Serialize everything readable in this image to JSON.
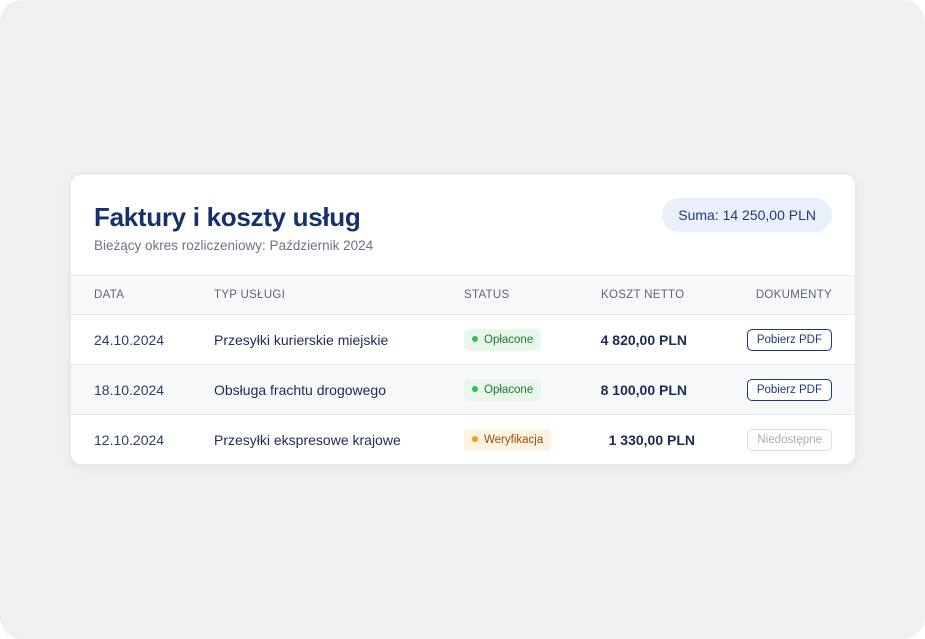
{
  "header": {
    "title": "Faktury i koszty usług",
    "subtitle": "Bieżący okres rozliczeniowy: Październik 2024",
    "sum_label": "Suma: 14 250,00 PLN"
  },
  "table": {
    "columns": {
      "date": "DATA",
      "type": "TYP USŁUGI",
      "status": "STATUS",
      "cost": "KOSZT NETTO",
      "documents": "DOKUMENTY"
    },
    "rows": [
      {
        "date": "24.10.2024",
        "type": "Przesyłki kurierskie miejskie",
        "status": "Opłacone",
        "status_kind": "paid",
        "cost": "4 820,00 PLN",
        "document": "Pobierz PDF",
        "document_enabled": true
      },
      {
        "date": "18.10.2024",
        "type": "Obsługa frachtu drogowego",
        "status": "Opłacone",
        "status_kind": "paid",
        "cost": "8 100,00 PLN",
        "document": "Pobierz PDF",
        "document_enabled": true
      },
      {
        "date": "12.10.2024",
        "type": "Przesyłki ekspresowe krajowe",
        "status": "Weryfikacja",
        "status_kind": "verification",
        "cost": "1 330,00 PLN",
        "document": "Niedostępne",
        "document_enabled": false
      }
    ]
  },
  "colors": {
    "primary": "#15306b",
    "paid": "#2fbf55",
    "verification": "#f39a1c",
    "background": "#f0f0f0"
  }
}
